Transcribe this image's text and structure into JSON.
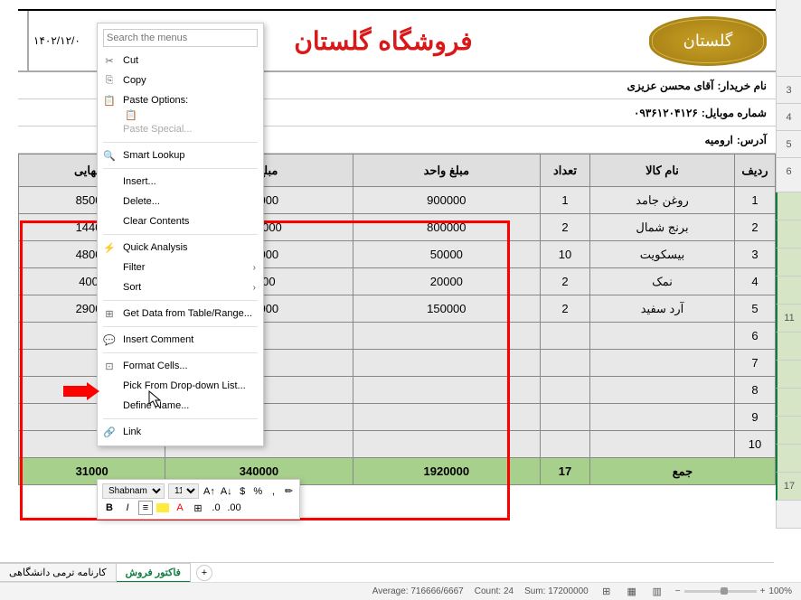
{
  "header": {
    "title": "فروشگاه گلستان",
    "date": "۱۴۰۲/۱۲/۰"
  },
  "info": {
    "buyer_label": "نام خریدار:",
    "buyer_value": "آقای محسن عزیزی",
    "mobile_label": "شماره موبایل:",
    "mobile_value": "۰۹۳۶۱۲۰۴۱۲۶",
    "address_label": "آدرس:",
    "address_value": "ارومیه"
  },
  "table": {
    "headers": {
      "row": "ردیف",
      "name": "نام کالا",
      "qty": "تعداد",
      "unit": "مبلغ واحد",
      "total": "مبلغ کل",
      "final": "غ نهایی"
    },
    "rows": [
      {
        "n": "1",
        "name": "روغن جامد",
        "qty": "1",
        "unit": "900000",
        "total": "900000",
        "final": "85000"
      },
      {
        "n": "2",
        "name": "برنج شمال",
        "qty": "2",
        "unit": "800000",
        "total": "1600000",
        "final": "14400"
      },
      {
        "n": "3",
        "name": "بیسکویت",
        "qty": "10",
        "unit": "50000",
        "total": "500000",
        "final": "48000"
      },
      {
        "n": "4",
        "name": "نمک",
        "qty": "2",
        "unit": "20000",
        "total": "40000",
        "final": "4000"
      },
      {
        "n": "5",
        "name": "آرد سفید",
        "qty": "2",
        "unit": "150000",
        "total": "300000",
        "final": "29000"
      },
      {
        "n": "6",
        "name": "",
        "qty": "",
        "unit": "",
        "total": "",
        "final": ""
      },
      {
        "n": "7",
        "name": "",
        "qty": "",
        "unit": "",
        "total": "",
        "final": ""
      },
      {
        "n": "8",
        "name": "",
        "qty": "",
        "unit": "",
        "total": "",
        "final": ""
      },
      {
        "n": "9",
        "name": "",
        "qty": "",
        "unit": "",
        "total": "",
        "final": ""
      },
      {
        "n": "10",
        "name": "",
        "qty": "",
        "unit": "",
        "total": "",
        "final": ""
      }
    ],
    "sum": {
      "label": "جمع",
      "qty": "17",
      "unit": "1920000",
      "total": "340000",
      "final": "31000"
    }
  },
  "context_menu": {
    "search_placeholder": "Search the menus",
    "cut": "Cut",
    "copy": "Copy",
    "paste_options": "Paste Options:",
    "paste_special": "Paste Special...",
    "smart_lookup": "Smart Lookup",
    "insert": "Insert...",
    "delete": "Delete...",
    "clear": "Clear Contents",
    "quick_analysis": "Quick Analysis",
    "filter": "Filter",
    "sort": "Sort",
    "get_data": "Get Data from Table/Range...",
    "insert_comment": "Insert Comment",
    "format_cells": "Format Cells...",
    "pick_list": "Pick From Drop-down List...",
    "define_name": "Define Name...",
    "link": "Link"
  },
  "mini_toolbar": {
    "font": "Shabnam",
    "size": "11"
  },
  "tabs": {
    "tab1": "فاکتور فروش",
    "tab2": "کارنامه ترمی دانشگاهی"
  },
  "status": {
    "average": "Average: 716666/6667",
    "count": "Count: 24",
    "sum": "Sum: 17200000",
    "zoom": "100%"
  },
  "row_nums": [
    "",
    "",
    "3",
    "4",
    "5",
    "",
    "6",
    "",
    "",
    "",
    "",
    "",
    "",
    "",
    "",
    "",
    "",
    "",
    "17",
    ""
  ]
}
